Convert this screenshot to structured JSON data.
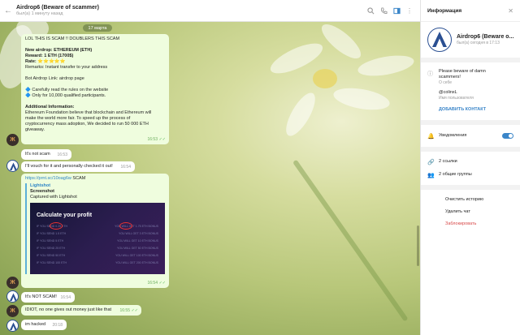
{
  "chat": {
    "title": "Airdrop6 (Beware of scammer)",
    "subtitle": "был(а) 1 минуту назад",
    "date": "17 марта"
  },
  "messages": {
    "m1": {
      "lines": [
        "LOL THIS IS SCAM !! DOUBLERS THIS SCAM",
        "",
        "New airdrop: ETHEREUM (ETH)",
        "Reward: 1 ETH (1700$)",
        "Rate: ⭐⭐⭐⭐⭐",
        "Remarks: Instant transfer to your address",
        "",
        "Bot Airdrop Link: airdrop page",
        "",
        "🔷 Carefully read the rules on the website",
        "🔷 Only for 10,000 qualified participants.",
        "",
        "Additional Information:",
        "Ethereum Foundation believe that blockchain and Ethereum will",
        "make the world more fair. To speed up the process of",
        "cryptocurrency mass adoption, We decided to run 50 000 ETH",
        "giveaway."
      ],
      "time": "16:53"
    },
    "m2": {
      "text": "It's not scam",
      "time": "16:53"
    },
    "m3": {
      "text": "I'll vouch for it and personally checked it out!",
      "time": "16:54"
    },
    "m4": {
      "link": "https://prnt.sc/10oag6w",
      "after": " SCAM",
      "site": "Lightshot",
      "ptitle": "Screenshot",
      "pdesc": "Captured with Lightshot",
      "img_title": "Calculate your profit",
      "rows": [
        [
          "IF YOU SEND 0.25 ETH",
          "YOU WILL GET 1.75 ETH BONUS"
        ],
        [
          "IF YOU SEND 1.5 ETH",
          "YOU WILL GET 3 ETH BONUS"
        ],
        [
          "IF YOU SEND 5 ETH",
          "YOU WILL GET 10 ETH BONUS"
        ],
        [
          "IF YOU SEND 25 ETH",
          "YOU WILL GET 50 ETH BONUS"
        ],
        [
          "IF YOU SEND 50 ETH",
          "YOU WILL GET 100 ETH BONUS"
        ],
        [
          "IF YOU SEND 100 ETH",
          "YOU WILL GET 200 ETH BONUS"
        ]
      ],
      "time": "16:54"
    },
    "m5": {
      "text": "It's NOT SCAM!",
      "time": "16:54"
    },
    "m6": {
      "text": "IDIOT, no one gives out money just like that",
      "time": "16:55"
    },
    "m7": {
      "text": "im hacked",
      "time": "20:18"
    }
  },
  "info": {
    "title": "Информация",
    "name": "Airdrop6 (Beware o...",
    "status": "был(а) сегодня в 17:13",
    "bio_line1": "Please beware of damn",
    "bio_line2": "scammers!",
    "bio_label": "О себе",
    "username": "@colinxL",
    "username_label": "Имя пользователя",
    "add_contact": "ДОБАВИТЬ КОНТАКТ",
    "notifications": "Уведомления",
    "links": "2 ссылки",
    "groups": "2 общие группы",
    "clear_history": "Очистить историю",
    "delete_chat": "Удалить чат",
    "block": "Заблокировать"
  },
  "icons": {
    "back": "back-arrow-icon",
    "search": "search-icon",
    "call": "phone-icon",
    "panel": "sidebar-toggle-icon",
    "more": "more-vert-icon",
    "close": "close-icon",
    "info": "info-icon",
    "bell": "bell-icon",
    "link": "link-icon",
    "group": "group-icon"
  },
  "colors": {
    "accent": "#3b86c9",
    "danger": "#d84a4a",
    "outgoing": "#effdde"
  }
}
